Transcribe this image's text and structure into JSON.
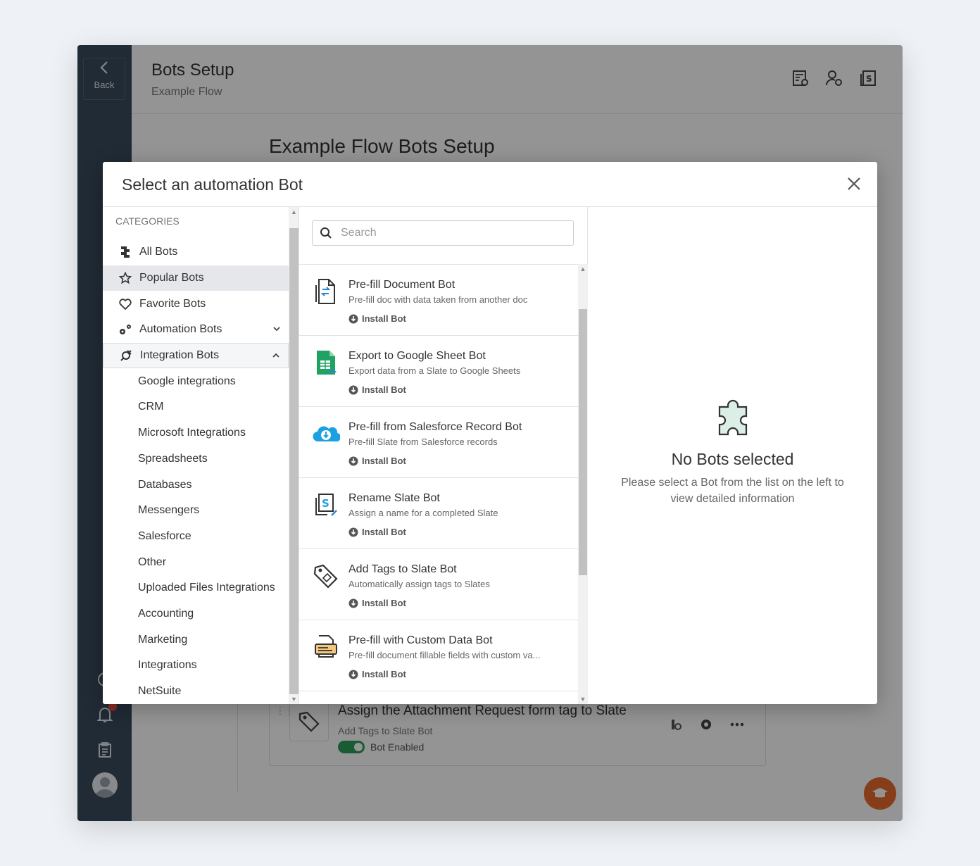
{
  "app": {
    "back_label": "Back",
    "title": "Bots Setup",
    "subtitle": "Example Flow",
    "page_title": "Example Flow Bots Setup"
  },
  "background_card": {
    "title": "Assign the Attachment Request form tag to Slate",
    "subtitle": "Add Tags to Slate Bot",
    "toggle_label": "Bot Enabled"
  },
  "modal": {
    "title": "Select an automation Bot",
    "categories_heading": "CATEGORIES",
    "categories": [
      {
        "label": "All Bots",
        "icon": "puzzle-icon"
      },
      {
        "label": "Popular Bots",
        "icon": "star-icon"
      },
      {
        "label": "Favorite Bots",
        "icon": "heart-icon"
      },
      {
        "label": "Automation Bots",
        "icon": "gears-icon"
      },
      {
        "label": "Integration Bots",
        "icon": "plug-icon"
      }
    ],
    "integration_subcategories": [
      "Google integrations",
      "CRM",
      "Microsoft Integrations",
      "Spreadsheets",
      "Databases",
      "Messengers",
      "Salesforce",
      "Other",
      "Uploaded Files Integrations",
      "Accounting",
      "Marketing",
      "Integrations",
      "NetSuite"
    ],
    "search_placeholder": "Search",
    "install_label": "Install Bot",
    "bots": [
      {
        "name": "Pre-fill Document Bot",
        "desc": "Pre-fill doc with data taken from another doc",
        "icon": "document-transfer-icon"
      },
      {
        "name": "Export to Google Sheet Bot",
        "desc": "Export data from a Slate to Google Sheets",
        "icon": "google-sheets-icon"
      },
      {
        "name": "Pre-fill from Salesforce Record Bot",
        "desc": "Pre-fill Slate from Salesforce records",
        "icon": "salesforce-cloud-icon"
      },
      {
        "name": "Rename Slate Bot",
        "desc": "Assign a name for a completed Slate",
        "icon": "rename-slate-icon"
      },
      {
        "name": "Add Tags to Slate Bot",
        "desc": "Automatically assign tags to Slates",
        "icon": "tag-icon"
      },
      {
        "name": "Pre-fill with Custom Data Bot",
        "desc": "Pre-fill document fillable fields with custom va...",
        "icon": "custom-data-icon"
      }
    ],
    "empty_title": "No Bots selected",
    "empty_text": "Please select a Bot from the list on the left to view detailed information"
  },
  "colors": {
    "sidebar": "#3a4a5c",
    "toggle_on": "#2e9e5b",
    "fab_learn": "#e56b2b",
    "fab_chat": "#2d86d2",
    "notification_badge": "#e84c3d"
  }
}
